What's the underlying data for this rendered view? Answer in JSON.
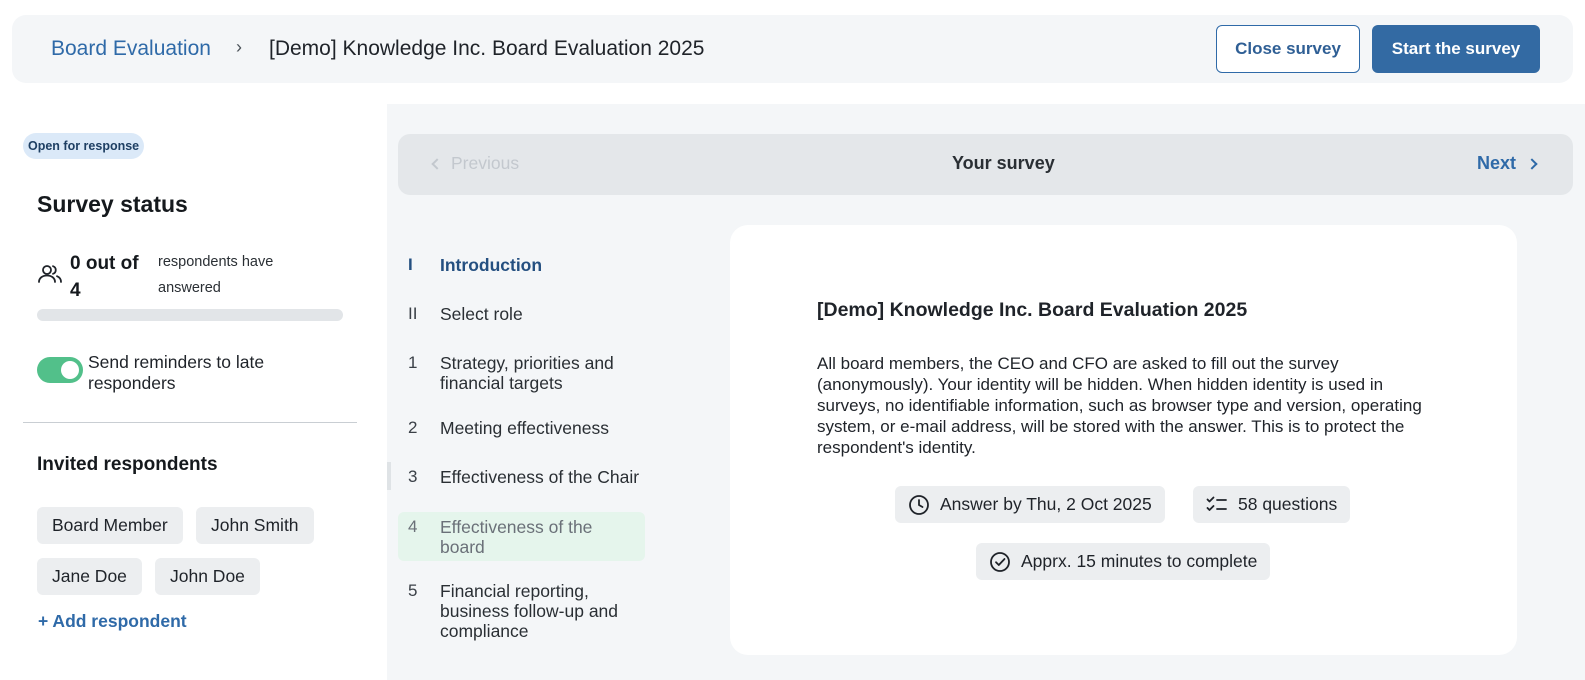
{
  "header": {
    "breadcrumb_root": "Board Evaluation",
    "breadcrumb_separator": "›",
    "breadcrumb_current": "[Demo] Knowledge Inc. Board Evaluation 2025",
    "close_label": "Close survey",
    "start_label": "Start the survey"
  },
  "status": {
    "badge": "Open for response",
    "title": "Survey status",
    "count": "0 out of 4",
    "count_text": "respondents have answered",
    "progress_fraction": 0,
    "reminder_label": "Send reminders to late responders",
    "reminder_enabled": true
  },
  "invited": {
    "title": "Invited respondents",
    "respondents": [
      "Board Member",
      "John Smith",
      "Jane Doe",
      "John Doe"
    ],
    "add_label": "+ Add respondent"
  },
  "nav": {
    "prev_label": "Previous",
    "title": "Your survey",
    "next_label": "Next"
  },
  "toc": [
    {
      "num": "I",
      "label": "Introduction",
      "state": "active"
    },
    {
      "num": "II",
      "label": "Select role",
      "state": ""
    },
    {
      "num": "1",
      "label": "Strategy, priorities and financial targets",
      "state": ""
    },
    {
      "num": "2",
      "label": "Meeting effectiveness",
      "state": ""
    },
    {
      "num": "3",
      "label": "Effectiveness of the Chair",
      "state": ""
    },
    {
      "num": "4",
      "label": "Effectiveness of the board",
      "state": "highlight"
    },
    {
      "num": "5",
      "label": "Financial reporting, business follow-up and compliance",
      "state": ""
    }
  ],
  "card": {
    "title": "[Demo] Knowledge Inc. Board Evaluation 2025",
    "body": "All board members, the CEO and CFO are asked to fill out the survey (anonymously). Your identity will be hidden. When hidden identity is used in surveys, no identifiable information, such as browser type and version, operating system, or e-mail address, will be stored with the answer. This is to protect the respondent's identity.",
    "deadline": "Answer by Thu, 2 Oct 2025",
    "questions": "58 questions",
    "duration": "Apprx. 15 minutes to complete"
  },
  "colors": {
    "accent": "#336aa3",
    "toggle_on": "#52c08a",
    "badge_bg": "#dbe9f8"
  },
  "icons": {
    "respondents": "people-icon",
    "deadline": "clock-icon",
    "questions": "checklist-icon",
    "duration": "check-circle-icon"
  }
}
